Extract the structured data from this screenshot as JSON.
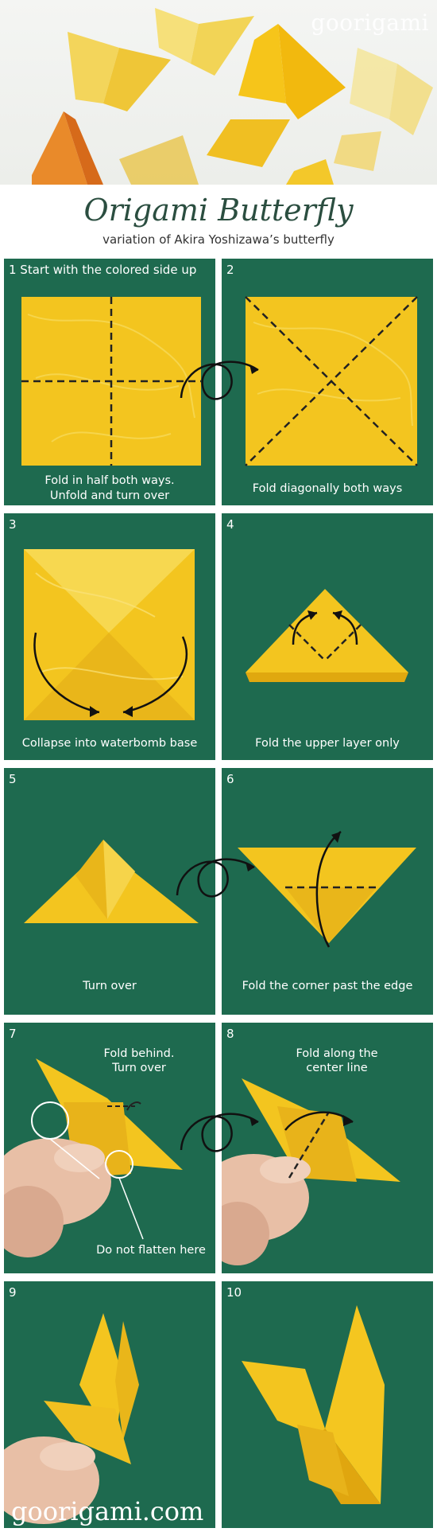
{
  "brand": "goorigami",
  "title": "Origami Butterfly",
  "subtitle": "variation of Akira Yoshizawa’s butterfly",
  "colors": {
    "paper": "#f2c21a",
    "paper_dark": "#d49a10",
    "background": "#1e6a4f",
    "title": "#2b4e40"
  },
  "steps": [
    {
      "number": "1 Start with the colored side up",
      "caption_line1": "Fold in half both ways.",
      "caption_line2": "Unfold and turn over"
    },
    {
      "number": "2",
      "caption": "Fold diagonally both ways"
    },
    {
      "number": "3",
      "caption": "Collapse into waterbomb base"
    },
    {
      "number": "4",
      "caption": "Fold the upper layer only"
    },
    {
      "number": "5",
      "caption": "Turn over"
    },
    {
      "number": "6",
      "caption": "Fold the corner past the edge"
    },
    {
      "number": "7",
      "note1_line1": "Fold behind.",
      "note1_line2": "Turn over",
      "note2": "Do not flatten here"
    },
    {
      "number": "8",
      "note_line1": "Fold along the",
      "note_line2": "center line"
    },
    {
      "number": "9"
    },
    {
      "number": "10"
    }
  ],
  "footer": "goorigami.com"
}
